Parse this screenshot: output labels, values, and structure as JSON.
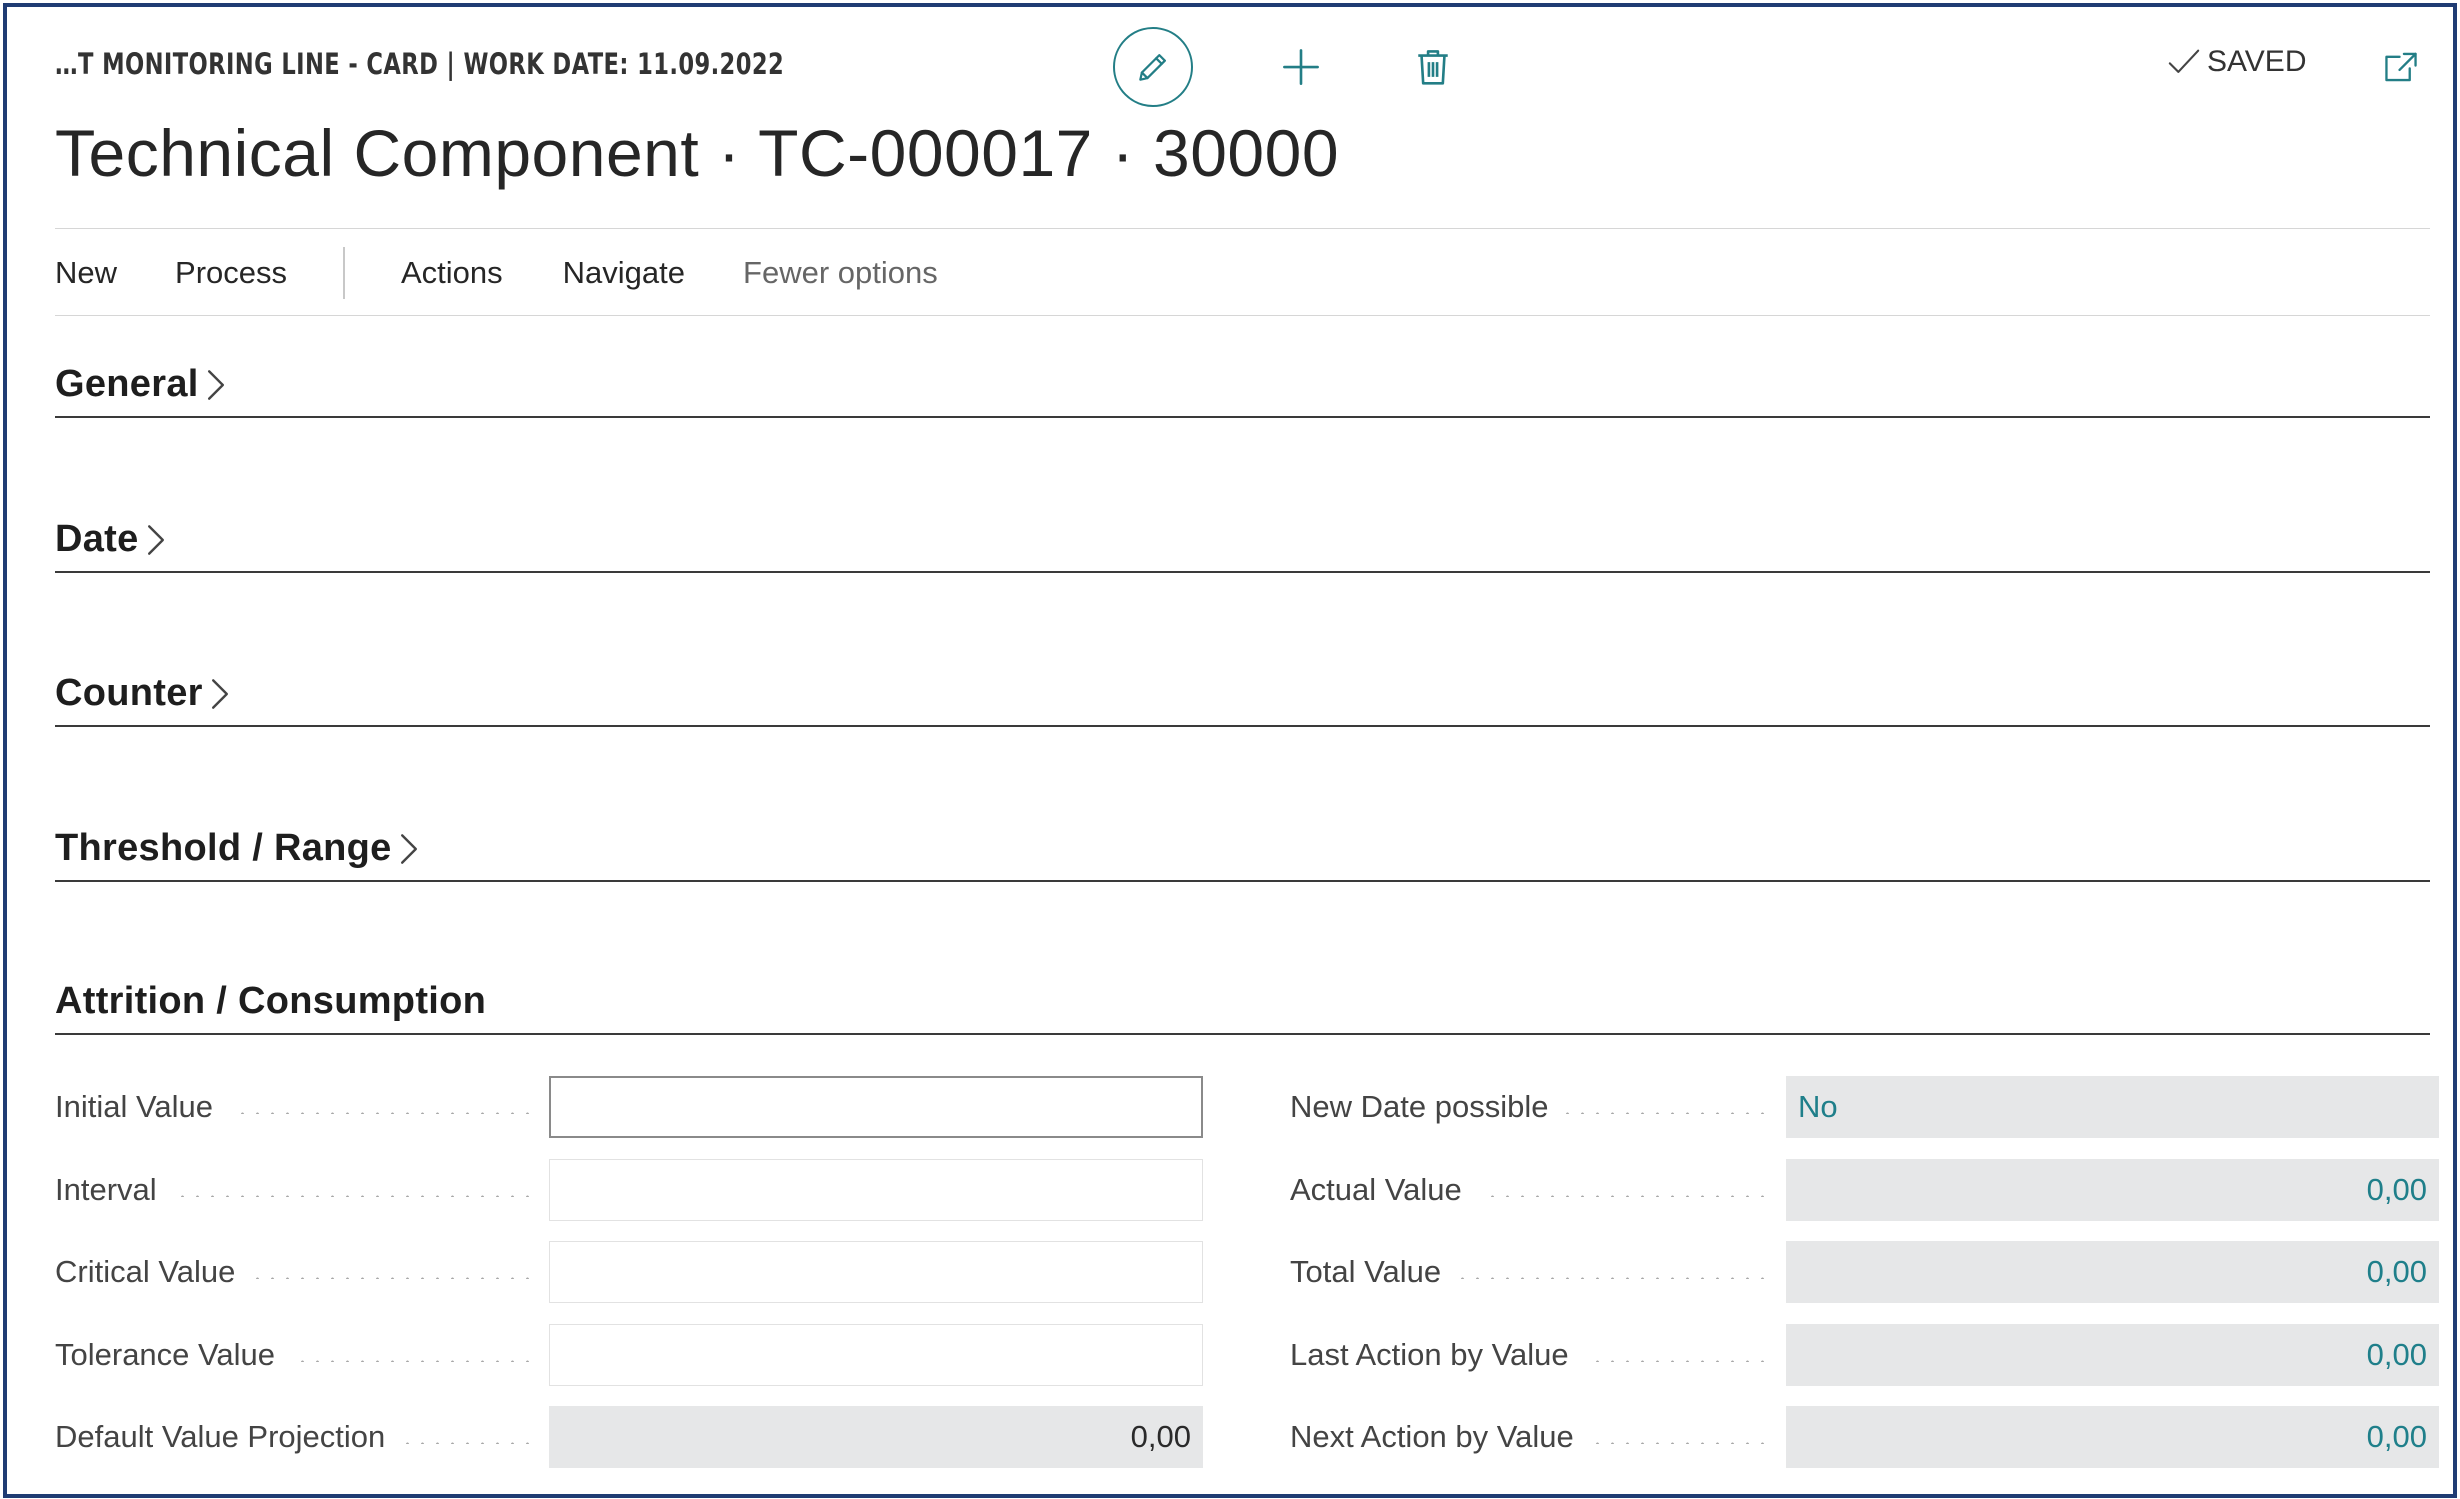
{
  "header": {
    "breadcrumb": "…T MONITORING LINE - CARD | WORK DATE: 11.09.2022",
    "title": "Technical Component · TC-000017 · 30000",
    "saved_label": "SAVED"
  },
  "icons": {
    "edit": "pencil-icon",
    "new": "plus-icon",
    "delete": "trash-icon",
    "saved": "checkmark-icon",
    "popout": "open-in-new-window-icon",
    "chevron": "chevron-right-icon"
  },
  "colors": {
    "accent": "#237e86",
    "frame": "#1f3c73",
    "readonly_bg": "#e6e7e8"
  },
  "action_bar": {
    "new": "New",
    "process": "Process",
    "actions": "Actions",
    "navigate": "Navigate",
    "fewer": "Fewer options"
  },
  "sections": {
    "general": "General",
    "date": "Date",
    "counter": "Counter",
    "threshold": "Threshold / Range",
    "attrition": "Attrition / Consumption"
  },
  "attrition": {
    "left": [
      {
        "label": "Initial Value",
        "value": ""
      },
      {
        "label": "Interval",
        "value": ""
      },
      {
        "label": "Critical Value",
        "value": ""
      },
      {
        "label": "Tolerance Value",
        "value": ""
      },
      {
        "label": "Default Value Projection",
        "value": "0,00"
      }
    ],
    "right": [
      {
        "label": "New Date possible",
        "value": "No"
      },
      {
        "label": "Actual Value",
        "value": "0,00"
      },
      {
        "label": "Total Value",
        "value": "0,00"
      },
      {
        "label": "Last Action by Value",
        "value": "0,00"
      },
      {
        "label": "Next Action by Value",
        "value": "0,00"
      }
    ]
  }
}
